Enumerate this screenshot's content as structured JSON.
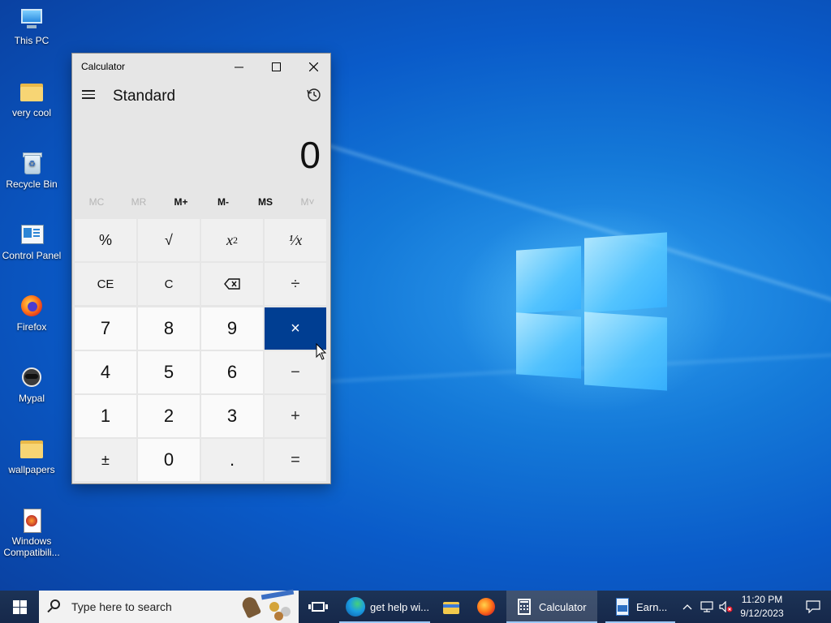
{
  "desktop": {
    "icons": [
      {
        "label": "This PC",
        "icon": "computer-icon"
      },
      {
        "label": "very cool",
        "icon": "user-folder-icon"
      },
      {
        "label": "Recycle Bin",
        "icon": "recycle-bin-icon"
      },
      {
        "label": "Control Panel",
        "icon": "control-panel-icon"
      },
      {
        "label": "Firefox",
        "icon": "firefox-icon"
      },
      {
        "label": "Mypal",
        "icon": "mypal-icon"
      },
      {
        "label": "wallpapers",
        "icon": "folder-icon"
      },
      {
        "label": "Windows Compatibili...",
        "icon": "firefox-installer-icon"
      }
    ]
  },
  "calculator": {
    "title": "Calculator",
    "mode": "Standard",
    "display": "0",
    "window_buttons": {
      "minimize": "—",
      "maximize": "☐",
      "close": "✕"
    },
    "memory": [
      "MC",
      "MR",
      "M+",
      "M-",
      "MS",
      "M˅"
    ],
    "memory_disabled": [
      true,
      true,
      false,
      false,
      false,
      true
    ],
    "keys": {
      "percent": "%",
      "sqrt": "√",
      "square": "x",
      "square_sup": "2",
      "reciprocal": "¹⁄x",
      "ce": "CE",
      "c": "C",
      "backspace": "⌫",
      "divide": "÷",
      "k7": "7",
      "k8": "8",
      "k9": "9",
      "multiply": "×",
      "k4": "4",
      "k5": "5",
      "k6": "6",
      "minus": "−",
      "k1": "1",
      "k2": "2",
      "k3": "3",
      "plus": "+",
      "negate": "±",
      "k0": "0",
      "decimal": ".",
      "equals": "="
    },
    "active_key": "multiply",
    "accent": "#003e92"
  },
  "taskbar": {
    "search_placeholder": "Type here to search",
    "apps": [
      {
        "label": "get help wi...",
        "icon": "edge-icon"
      },
      {
        "label": "Calculator",
        "icon": "calculator-icon",
        "active": true
      },
      {
        "label": "Earn...",
        "icon": "wordpad-icon"
      }
    ],
    "clock_time": "11:20 PM",
    "clock_date": "9/12/2023"
  }
}
